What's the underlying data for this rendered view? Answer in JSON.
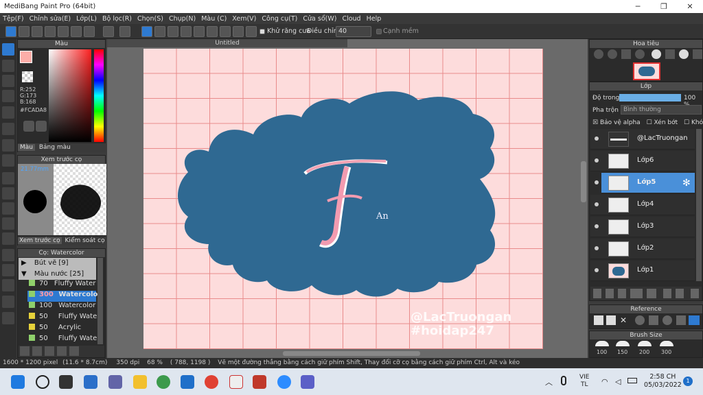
{
  "window": {
    "title": "MediBang Paint Pro (64bit)"
  },
  "menu": [
    "Tệp(F)",
    "Chỉnh sửa(E)",
    "Lớp(L)",
    "Bộ lọc(R)",
    "Chọn(S)",
    "Chụp(N)",
    "Màu (C)",
    "Xem(V)",
    "Công cụ(T)",
    "Cửa sổ(W)",
    "Cloud",
    "Help"
  ],
  "toolbar": {
    "antialias_label": "Khử răng cưa",
    "adjust_label": "Điều chỉnh",
    "adjust_value": "40",
    "smooth_label": "Cạnh mềm"
  },
  "color_panel": {
    "title": "Màu",
    "r": "R:252",
    "g": "G:173",
    "b": "B:168",
    "hex": "#FCADA8",
    "tab_color": "Màu",
    "tab_palette": "Bảng màu",
    "main_color": "#FCADA8"
  },
  "brush_preview": {
    "title": "Xem trước cọ",
    "size": "21.77mm",
    "tab_preview": "Xem trước cọ",
    "tab_control": "Kiểm soát cọ"
  },
  "brush_panel": {
    "title": "Cọ: Watercolor",
    "groups": [
      "Bút vẽ [9]",
      "Màu nước [25]"
    ],
    "items": [
      {
        "size": "70",
        "name": "Fluffy Water",
        "color": "#8fd06b"
      },
      {
        "size": "300",
        "name": "Watercolor",
        "color": "#8fd06b"
      },
      {
        "size": "100",
        "name": "Watercolor (",
        "color": "#8fd06b"
      },
      {
        "size": "50",
        "name": "Fluffy Water",
        "color": "#e6d23a"
      },
      {
        "size": "50",
        "name": "Acrylic",
        "color": "#e6d23a"
      },
      {
        "size": "50",
        "name": "Fluffy Water",
        "color": "#8fd06b"
      }
    ]
  },
  "canvas": {
    "tab": "Untitled",
    "watermark_1": "@LacTruongan",
    "watermark_2": "#hoidap247",
    "signature": "An"
  },
  "navigator": {
    "title": "Hoa tiêu"
  },
  "layer_panel": {
    "title": "Lớp",
    "opacity_label": "Độ trong",
    "opacity_value": "100 %",
    "blend_label": "Pha trộn",
    "blend_value": "Bình thường",
    "protect_alpha": "Bảo vệ alpha",
    "clip": "Xén bớt",
    "lock": "Khóa",
    "layers": [
      "@LacTruongan",
      "Lớp6",
      "Lớp5",
      "Lớp4",
      "Lớp3",
      "Lớp2",
      "Lớp1"
    ]
  },
  "reference_panel": {
    "title": "Reference"
  },
  "brush_size_panel": {
    "title": "Brush Size",
    "sizes": [
      "100",
      "150",
      "200",
      "300"
    ]
  },
  "status": {
    "size": "1600 * 1200 pixel",
    "physical": "(11.6 * 8.7cm)",
    "dpi": "350 dpi",
    "zoom": "68 %",
    "coords": "( 788, 1198 )",
    "hint": "Vẽ một đường thẳng bằng cách giữ phím Shift, Thay đổi cỡ cọ bằng cách giữ phím Ctrl, Alt và kéo"
  },
  "taskbar": {
    "lang1": "VIE",
    "lang2": "TL",
    "time": "2:58 CH",
    "date": "05/03/2022",
    "notif": "1"
  }
}
